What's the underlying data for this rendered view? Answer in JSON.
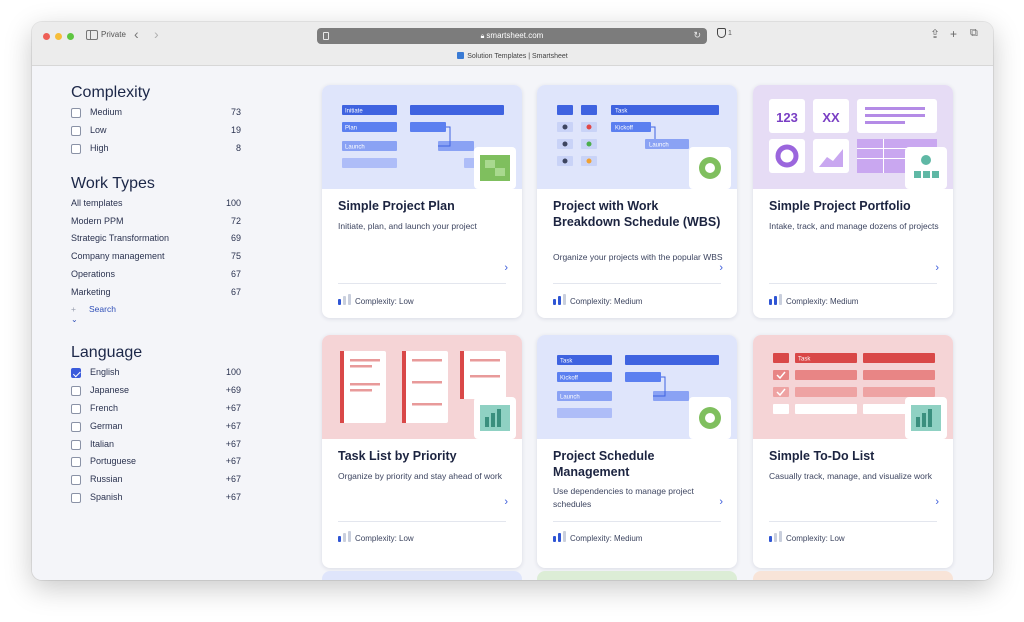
{
  "browser": {
    "private_label": "Private",
    "url": "smartsheet.com",
    "shield_count": "1",
    "tab_title": "Solution Templates | Smartsheet"
  },
  "filters": {
    "complexity": {
      "heading": "Complexity",
      "items": [
        {
          "label": "Medium",
          "count": "73",
          "checked": false
        },
        {
          "label": "Low",
          "count": "19",
          "checked": false
        },
        {
          "label": "High",
          "count": "8",
          "checked": false
        }
      ]
    },
    "work_types": {
      "heading": "Work Types",
      "items": [
        {
          "label": "All templates",
          "count": "100"
        },
        {
          "label": "Modern PPM",
          "count": "72"
        },
        {
          "label": "Strategic Transformation",
          "count": "69"
        },
        {
          "label": "Company management",
          "count": "75"
        },
        {
          "label": "Operations",
          "count": "67"
        },
        {
          "label": "Marketing",
          "count": "67"
        }
      ],
      "search_label": "Search"
    },
    "language": {
      "heading": "Language",
      "items": [
        {
          "label": "English",
          "count": "100",
          "checked": true
        },
        {
          "label": "Japanese",
          "count": "+69",
          "checked": false
        },
        {
          "label": "French",
          "count": "+67",
          "checked": false
        },
        {
          "label": "German",
          "count": "+67",
          "checked": false
        },
        {
          "label": "Italian",
          "count": "+67",
          "checked": false
        },
        {
          "label": "Portuguese",
          "count": "+67",
          "checked": false
        },
        {
          "label": "Russian",
          "count": "+67",
          "checked": false
        },
        {
          "label": "Spanish",
          "count": "+67",
          "checked": false
        }
      ]
    }
  },
  "cards": [
    {
      "title": "Simple Project Plan",
      "description": "Initiate, plan, and launch your project",
      "complexity": "Complexity: Low",
      "level": 1,
      "thumb_labels": [
        "Initiate",
        "Plan",
        "Launch"
      ]
    },
    {
      "title": "Project with Work Breakdown Schedule (WBS)",
      "description": "Organize your projects with the popular WBS",
      "complexity": "Complexity: Medium",
      "level": 2,
      "thumb_labels": [
        "Task",
        "Kickoff",
        "Launch"
      ]
    },
    {
      "title": "Simple Project Portfolio",
      "description": "Intake, track, and manage dozens of projects",
      "complexity": "Complexity: Medium",
      "level": 2,
      "thumb_labels": [
        "123",
        "XX"
      ]
    },
    {
      "title": "Task List by Priority",
      "description": "Organize by priority and stay ahead of work",
      "complexity": "Complexity: Low",
      "level": 1,
      "thumb_labels": []
    },
    {
      "title": "Project Schedule Management",
      "description": "Use dependencies to manage project schedules",
      "complexity": "Complexity: Medium",
      "level": 2,
      "thumb_labels": [
        "Task",
        "Kickoff",
        "Launch"
      ]
    },
    {
      "title": "Simple To-Do List",
      "description": "Casually track, manage, and visualize work",
      "complexity": "Complexity: Low",
      "level": 1,
      "thumb_labels": [
        "Task"
      ]
    }
  ],
  "colors": {
    "accent": "#3b5bdb",
    "thumb_blue": "#dfe5fb",
    "thumb_purple": "#e6dcf5",
    "thumb_red": "#f5d4d6",
    "thumb_green": "#dcedd6",
    "thumb_peach": "#f8e4d8"
  }
}
